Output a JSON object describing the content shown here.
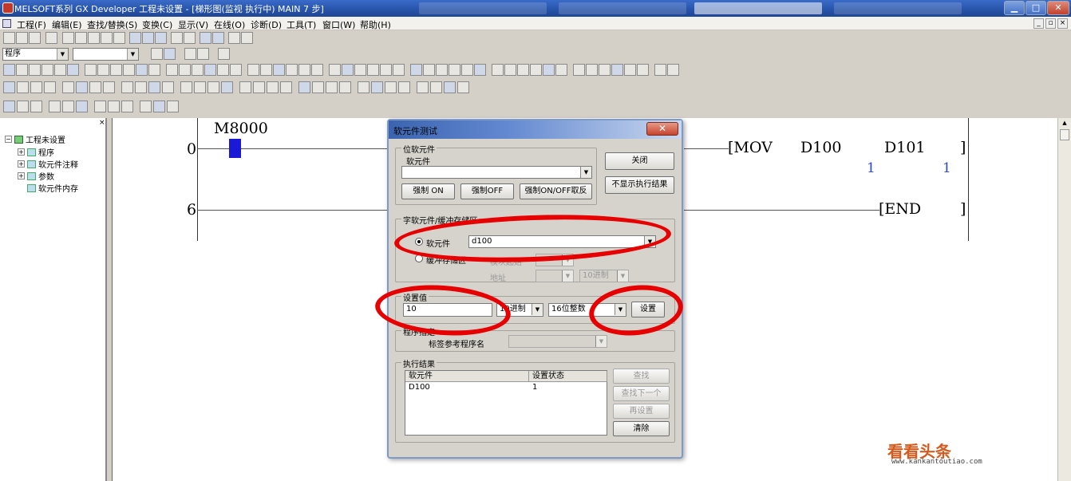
{
  "window": {
    "title": "MELSOFT系列 GX Developer 工程未设置 - [梯形图(监视 执行中)    MAIN    7 步]",
    "controls": {
      "minimize": "▁",
      "maximize": "□",
      "close": "✕"
    }
  },
  "menu": {
    "items": [
      "工程(F)",
      "编辑(E)",
      "查找/替换(S)",
      "变换(C)",
      "显示(V)",
      "在线(O)",
      "诊断(D)",
      "工具(T)",
      "窗口(W)",
      "帮助(H)"
    ],
    "mdi_controls": [
      "_",
      "▫",
      "×"
    ]
  },
  "toolbar": {
    "data_type_combo": "程序"
  },
  "tree": {
    "close": "×",
    "root": "工程未设置",
    "items": [
      "程序",
      "软元件注释",
      "参数",
      "软元件内存"
    ]
  },
  "ladder": {
    "rung1_step": "0",
    "rung1_contact": "M8000",
    "rung1_instr": "[MOV",
    "rung1_src": "D100",
    "rung1_dst": "D101",
    "rung1_close": "]",
    "rung1_src_value": "1",
    "rung1_dst_value": "1",
    "rung2_step": "6",
    "rung2_instr": "[END",
    "rung2_close": "]"
  },
  "dialog": {
    "title": "软元件测试",
    "close_glyph": "✕",
    "bit_group": {
      "label": "位软元件",
      "device_label": "软元件",
      "device_value": "",
      "force_on": "强制 ON",
      "force_off": "强制OFF",
      "force_toggle": "强制ON/OFF取反"
    },
    "close_button": "关闭",
    "hide_result_button": "不显示执行结果",
    "word_group": {
      "label": "字软元件/缓冲存储区",
      "device_radio": "软元件",
      "device_value": "d100",
      "buffer_radio": "缓冲存储区",
      "module_start_label": "模块起始",
      "address_label": "地址",
      "address_base": "10进制"
    },
    "set_value_group": {
      "label": "设置值",
      "value": "10",
      "base": "10进制",
      "type": "16位整数",
      "set_button": "设置"
    },
    "program_group": {
      "label": "程序指定",
      "label_ref": "标签参考程序名"
    },
    "result_group": {
      "label": "执行结果",
      "columns": [
        "软元件",
        "设置状态"
      ],
      "rows": [
        [
          "D100",
          "1"
        ]
      ],
      "find": "查找",
      "find_next": "查找下一个",
      "reset": "再设置",
      "clear": "清除"
    }
  },
  "watermark": {
    "brand": "看看头条",
    "url": "www.kankantoutiao.com"
  },
  "colors": {
    "title_bar": "#2753a8",
    "annotation_red": "#e60000",
    "monitor_value_blue": "#2848c0",
    "contact_on": "#1a1ad6"
  }
}
